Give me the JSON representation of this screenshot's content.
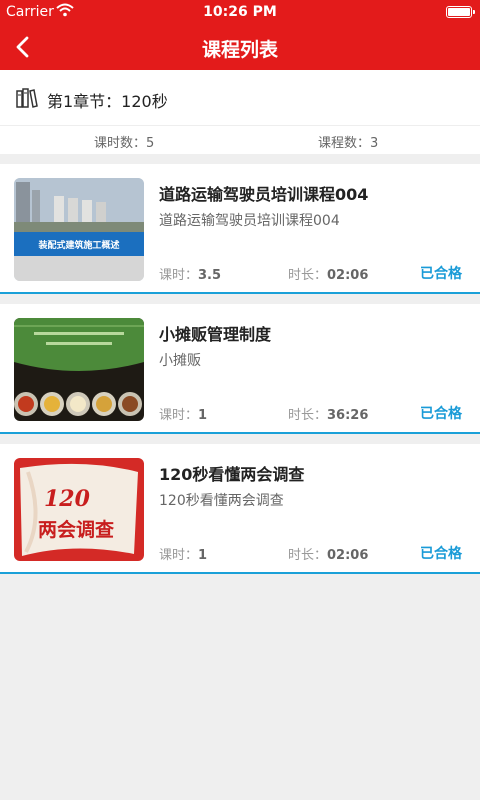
{
  "status_bar": {
    "carrier": "Carrier",
    "time": "10:26 PM"
  },
  "nav": {
    "title": "课程列表"
  },
  "chapter": {
    "title": "第1章节：120秒"
  },
  "stats": {
    "lesson_hours": "课时数：5",
    "course_count": "课程数：3"
  },
  "labels": {
    "hours": "课时：",
    "duration": "时长："
  },
  "courses": [
    {
      "title": "道路运输驾驶员培训课程004",
      "subtitle": "道路运输驾驶员培训课程004",
      "hours": "3.5",
      "duration": "02:06",
      "status": "已合格",
      "banner_text": "装配式建筑施工概述"
    },
    {
      "title": "小摊贩管理制度",
      "subtitle": "小摊贩",
      "hours": "1",
      "duration": "36:26",
      "status": "已合格"
    },
    {
      "title": "120秒看懂两会调查",
      "subtitle": "120秒看懂两会调查",
      "hours": "1",
      "duration": "02:06",
      "status": "已合格",
      "poster_number": "120",
      "poster_text": "两会调查"
    }
  ],
  "colors": {
    "brand_red": "#e31b1b",
    "accent_blue": "#1a9bd7",
    "background": "#efefef"
  }
}
